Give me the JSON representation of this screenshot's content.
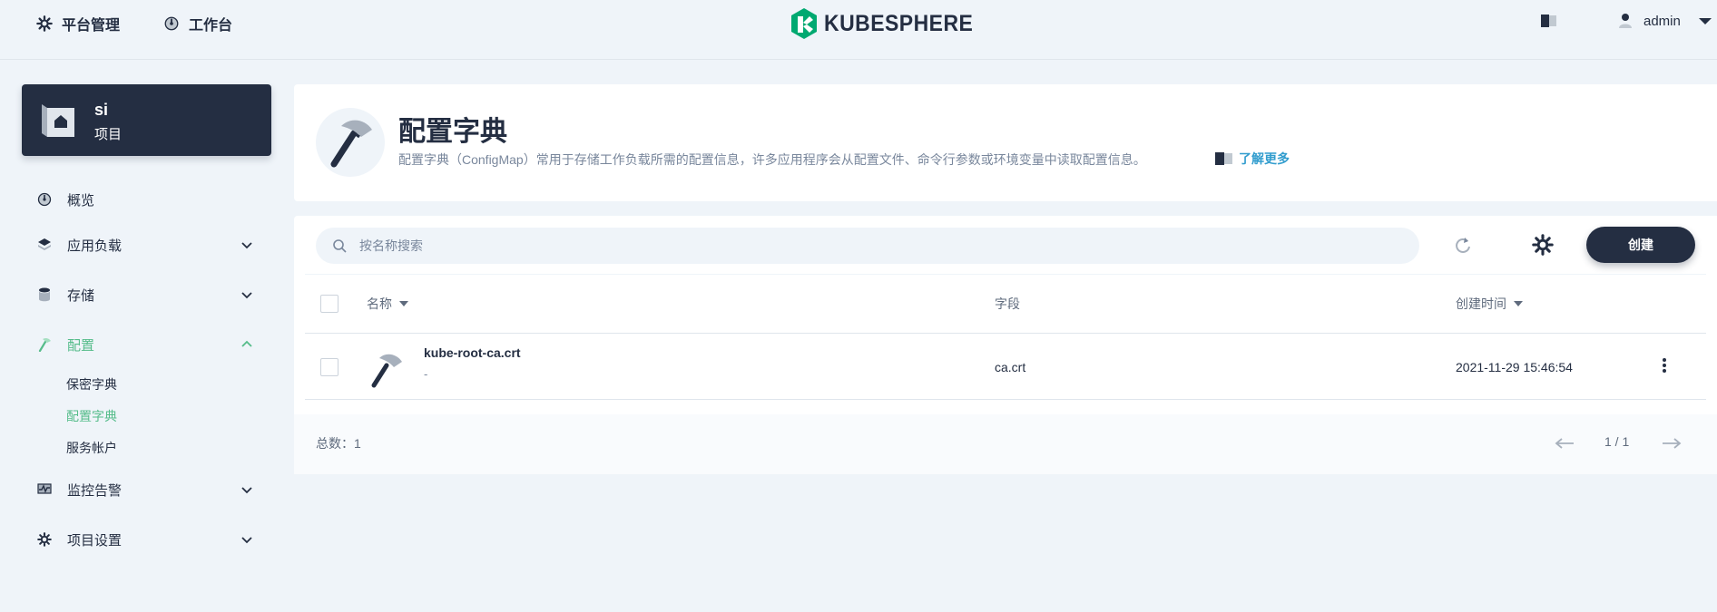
{
  "header": {
    "nav_platform": "平台管理",
    "nav_workbench": "工作台",
    "logo_text": "KUBESPHERE",
    "username": "admin"
  },
  "project": {
    "name": "si",
    "type": "项目"
  },
  "sidebar": {
    "items": [
      {
        "label": "概览",
        "icon": "dashboard-icon"
      },
      {
        "label": "应用负载",
        "icon": "layers-icon"
      },
      {
        "label": "存储",
        "icon": "database-icon"
      },
      {
        "label": "配置",
        "icon": "hammer-icon"
      },
      {
        "label": "监控告警",
        "icon": "monitor-icon"
      },
      {
        "label": "项目设置",
        "icon": "gear-icon"
      }
    ],
    "config_sub": [
      "保密字典",
      "配置字典",
      "服务帐户"
    ],
    "active_item": "配置",
    "active_sub": "配置字典"
  },
  "banner": {
    "title": "配置字典",
    "description": "配置字典（ConfigMap）常用于存储工作负载所需的配置信息，许多应用程序会从配置文件、命令行参数或环境变量中读取配置信息。",
    "learn_more": "了解更多"
  },
  "toolbar": {
    "search_placeholder": "按名称搜索",
    "create_label": "创建"
  },
  "table": {
    "columns": [
      "名称",
      "字段",
      "创建时间"
    ],
    "rows": [
      {
        "name": "kube-root-ca.crt",
        "description": "-",
        "field": "ca.crt",
        "created": "2021-11-29 15:46:54"
      }
    ],
    "total_label": "总数：1",
    "page": "1 / 1"
  },
  "colors": {
    "primary": "#242e42",
    "active": "#55bc8a",
    "link": "#329dce",
    "background": "#eff4f9",
    "logo_green": "#00a971"
  }
}
